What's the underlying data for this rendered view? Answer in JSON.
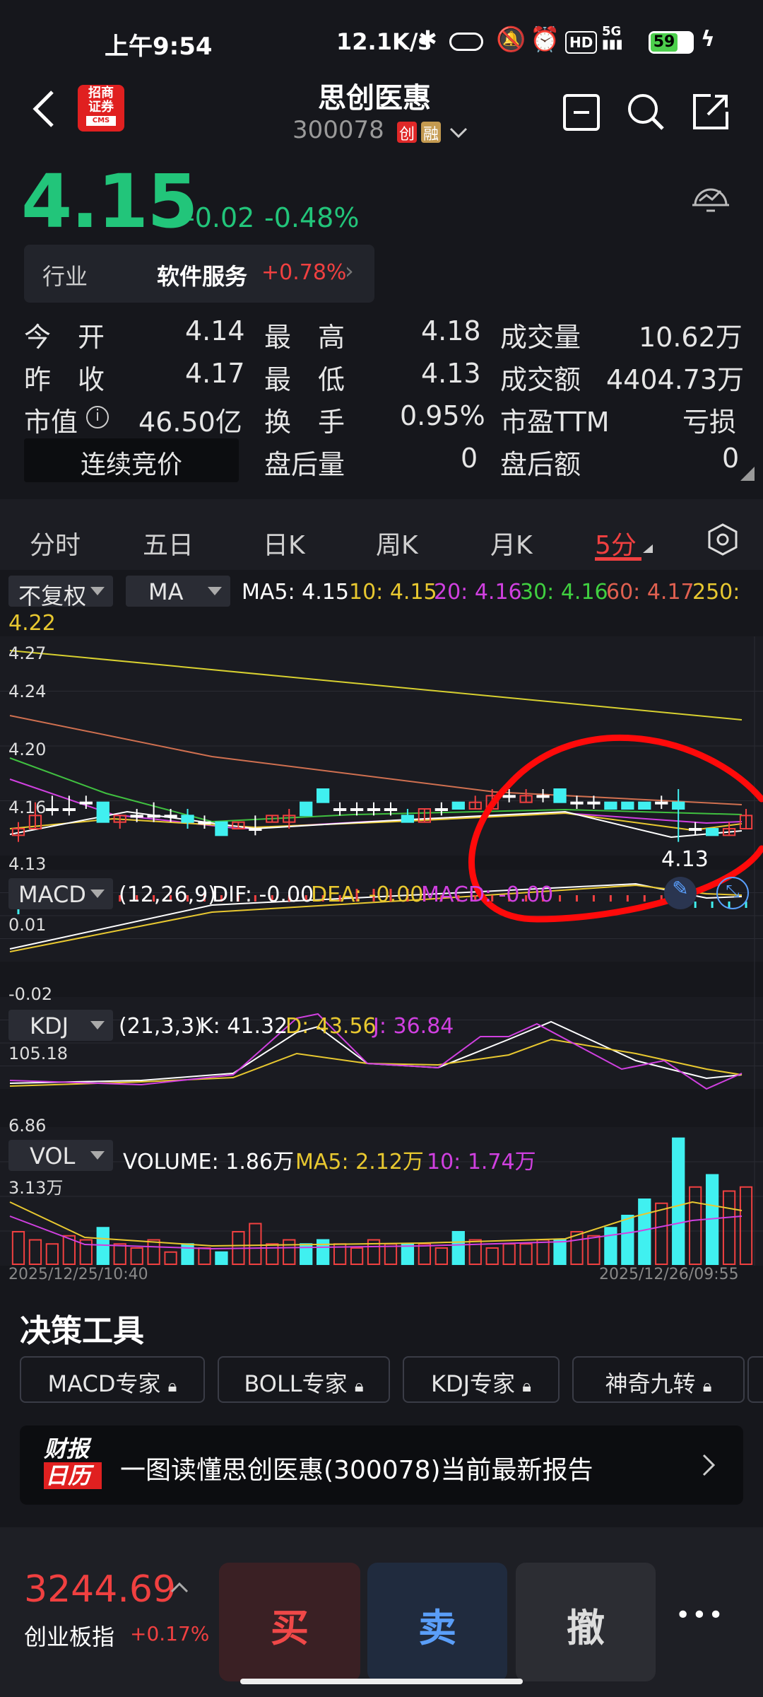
{
  "status_bar": {
    "time": "上午9:54",
    "net_speed": "12.1K/s",
    "battery": "59",
    "icons": [
      "bluetooth-icon",
      "vibrate-icon",
      "mute-icon",
      "alarm-icon",
      "hd-icon",
      "signal-5g-icon",
      "battery-icon",
      "charging-icon"
    ]
  },
  "header": {
    "title": "思创医惠",
    "code": "300078",
    "badge_chuang": "创",
    "badge_rong": "融",
    "broker_logo_text": [
      "招商",
      "证券",
      "CMS"
    ]
  },
  "quote": {
    "price": "4.15",
    "change": "-0.02",
    "change_pct": "-0.48%",
    "industry_label": "行业",
    "industry_name": "软件服务",
    "industry_change": "+0.78%"
  },
  "stats": {
    "open_label": "今　开",
    "open": "4.14",
    "high_label": "最　高",
    "high": "4.18",
    "volume_label": "成交量",
    "volume": "10.62万",
    "prev_close_label": "昨　收",
    "prev_close": "4.17",
    "low_label": "最　低",
    "low": "4.13",
    "amount_label": "成交额",
    "amount": "4404.73万",
    "mktcap_label": "市值",
    "mktcap": "46.50亿",
    "turnover_label": "换　手",
    "turnover": "0.95%",
    "pe_label": "市盈TTM",
    "pe": "亏损",
    "auction_label": "连续竞价",
    "after_vol_label": "盘后量",
    "after_vol": "0",
    "after_amt_label": "盘后额",
    "after_amt": "0"
  },
  "tabs": [
    "分时",
    "五日",
    "日K",
    "周K",
    "月K",
    "5分"
  ],
  "chart_controls": {
    "adjust": "不复权",
    "ma": "MA",
    "ma5": "MA5: 4.15",
    "ma10": "10: 4.15",
    "ma20": "20: 4.16",
    "ma30": "30: 4.16",
    "ma60": "60: 4.17",
    "ma250_label": "250:",
    "ma250": "4.22"
  },
  "main_axis": {
    "y_top": "4.27",
    "y2": "4.24",
    "y3": "4.20",
    "y4": "4.16",
    "y_bot": "4.13",
    "low_marker": "4.13"
  },
  "macd": {
    "name": "MACD",
    "params": "(12,26,9)",
    "dif": "DIF: -0.00",
    "dea": "DEA: -0.00",
    "macd": "MACD: -0.00",
    "y_top": "0.01",
    "y_bot": "-0.02"
  },
  "kdj": {
    "name": "KDJ",
    "params": "(21,3,3)",
    "k": "K: 41.32",
    "d": "D: 43.56",
    "j": "J: 36.84",
    "y_top": "105.18",
    "y_bot": "6.86"
  },
  "vol": {
    "name": "VOL",
    "volume": "VOLUME: 1.86万",
    "ma5": "MA5: 2.12万",
    "ma10": "10: 1.74万",
    "y_top": "3.13万",
    "date_left": "2025/12/25/10:40",
    "date_right": "2025/12/26/09:55"
  },
  "chart_data": {
    "type": "candlestick",
    "x_start": "2025/12/25/10:40",
    "x_end": "2025/12/26/09:55",
    "ylim": [
      4.125,
      4.275
    ],
    "candles": [
      {
        "o": 4.135,
        "c": 4.14,
        "h": 4.145,
        "l": 4.13
      },
      {
        "o": 4.14,
        "c": 4.15,
        "h": 4.16,
        "l": 4.14
      },
      {
        "o": 4.155,
        "c": 4.155,
        "h": 4.165,
        "l": 4.15
      },
      {
        "o": 4.155,
        "c": 4.155,
        "h": 4.165,
        "l": 4.15
      },
      {
        "o": 4.16,
        "c": 4.16,
        "h": 4.165,
        "l": 4.155
      },
      {
        "o": 4.16,
        "c": 4.145,
        "h": 4.16,
        "l": 4.145
      },
      {
        "o": 4.145,
        "c": 4.15,
        "h": 4.15,
        "l": 4.14
      },
      {
        "o": 4.15,
        "c": 4.15,
        "h": 4.155,
        "l": 4.145
      },
      {
        "o": 4.15,
        "c": 4.15,
        "h": 4.16,
        "l": 4.145
      },
      {
        "o": 4.15,
        "c": 4.15,
        "h": 4.155,
        "l": 4.145
      },
      {
        "o": 4.15,
        "c": 4.145,
        "h": 4.155,
        "l": 4.14
      },
      {
        "o": 4.145,
        "c": 4.145,
        "h": 4.15,
        "l": 4.14
      },
      {
        "o": 4.145,
        "c": 4.135,
        "h": 4.145,
        "l": 4.135
      },
      {
        "o": 4.14,
        "c": 4.145,
        "h": 4.145,
        "l": 4.14
      },
      {
        "o": 4.14,
        "c": 4.14,
        "h": 4.15,
        "l": 4.135
      },
      {
        "o": 4.145,
        "c": 4.15,
        "h": 4.15,
        "l": 4.145
      },
      {
        "o": 4.145,
        "c": 4.15,
        "h": 4.155,
        "l": 4.14
      },
      {
        "o": 4.16,
        "c": 4.15,
        "h": 4.16,
        "l": 4.15
      },
      {
        "o": 4.17,
        "c": 4.16,
        "h": 4.17,
        "l": 4.16
      },
      {
        "o": 4.155,
        "c": 4.155,
        "h": 4.16,
        "l": 4.15
      },
      {
        "o": 4.155,
        "c": 4.155,
        "h": 4.16,
        "l": 4.15
      },
      {
        "o": 4.155,
        "c": 4.155,
        "h": 4.16,
        "l": 4.15
      },
      {
        "o": 4.155,
        "c": 4.155,
        "h": 4.16,
        "l": 4.15
      },
      {
        "o": 4.15,
        "c": 4.145,
        "h": 4.155,
        "l": 4.145
      },
      {
        "o": 4.145,
        "c": 4.155,
        "h": 4.155,
        "l": 4.145
      },
      {
        "o": 4.155,
        "c": 4.155,
        "h": 4.16,
        "l": 4.15
      },
      {
        "o": 4.16,
        "c": 4.155,
        "h": 4.16,
        "l": 4.155
      },
      {
        "o": 4.155,
        "c": 4.16,
        "h": 4.165,
        "l": 4.155
      },
      {
        "o": 4.155,
        "c": 4.165,
        "h": 4.17,
        "l": 4.155
      },
      {
        "o": 4.165,
        "c": 4.165,
        "h": 4.17,
        "l": 4.16
      },
      {
        "o": 4.16,
        "c": 4.165,
        "h": 4.17,
        "l": 4.16
      },
      {
        "o": 4.165,
        "c": 4.165,
        "h": 4.17,
        "l": 4.16
      },
      {
        "o": 4.17,
        "c": 4.16,
        "h": 4.17,
        "l": 4.16
      },
      {
        "o": 4.16,
        "c": 4.16,
        "h": 4.165,
        "l": 4.155
      },
      {
        "o": 4.16,
        "c": 4.16,
        "h": 4.165,
        "l": 4.155
      },
      {
        "o": 4.16,
        "c": 4.155,
        "h": 4.16,
        "l": 4.155
      },
      {
        "o": 4.16,
        "c": 4.155,
        "h": 4.16,
        "l": 4.155
      },
      {
        "o": 4.16,
        "c": 4.155,
        "h": 4.16,
        "l": 4.155
      },
      {
        "o": 4.16,
        "c": 4.16,
        "h": 4.165,
        "l": 4.155
      },
      {
        "o": 4.16,
        "c": 4.155,
        "h": 4.17,
        "l": 4.13
      },
      {
        "o": 4.14,
        "c": 4.14,
        "h": 4.145,
        "l": 4.135
      },
      {
        "o": 4.14,
        "c": 4.135,
        "h": 4.14,
        "l": 4.135
      },
      {
        "o": 4.135,
        "c": 4.14,
        "h": 4.145,
        "l": 4.135
      },
      {
        "o": 4.14,
        "c": 4.15,
        "h": 4.155,
        "l": 4.14
      }
    ],
    "volume": [
      0.8,
      0.6,
      0.5,
      0.7,
      0.6,
      0.9,
      0.5,
      0.4,
      0.6,
      0.3,
      0.5,
      0.4,
      0.3,
      0.8,
      1.0,
      0.5,
      0.6,
      0.5,
      0.6,
      0.5,
      0.4,
      0.6,
      0.5,
      0.5,
      0.5,
      0.4,
      0.8,
      0.6,
      0.4,
      0.5,
      0.5,
      0.6,
      0.6,
      0.8,
      0.7,
      0.9,
      1.2,
      1.6,
      1.5,
      3.1,
      1.9,
      2.2,
      1.8,
      1.9
    ],
    "macd_hist": [
      -0.002,
      0.001,
      0.001,
      0.001,
      0.001,
      0.001,
      0.001,
      0.001,
      0.001,
      0.001,
      0.001,
      0.001,
      0.001,
      0.001,
      0.001,
      0.001,
      0.001,
      0.001,
      0.001,
      0.001,
      0.002,
      0.002,
      0.002,
      0.002,
      0.002,
      0.001,
      0.001,
      0.001,
      0.001,
      0.001,
      0.001,
      0.001,
      0.001,
      0.001,
      0.001,
      0.001,
      0.001,
      0.001,
      0.001,
      -0.001,
      -0.001,
      -0.001,
      -0.001,
      -0.001
    ]
  },
  "decision": {
    "title": "决策工具",
    "chips": [
      "MACD专家",
      "BOLL专家",
      "KDJ专家",
      "神奇九转"
    ]
  },
  "report": {
    "logo_top": "财报",
    "logo_bottom": "日历",
    "text": "一图读懂思创医惠(300078)当前最新报告"
  },
  "bottom_bar": {
    "index_value": "3244.69",
    "index_name": "创业板指",
    "index_change": "+0.17%",
    "buy": "买",
    "sell": "卖",
    "cancel": "撤",
    "more": "•••"
  },
  "colors": {
    "up": "#f04040",
    "down": "#22c57a",
    "cyan": "#40f0f0",
    "bg": "#16171c"
  }
}
